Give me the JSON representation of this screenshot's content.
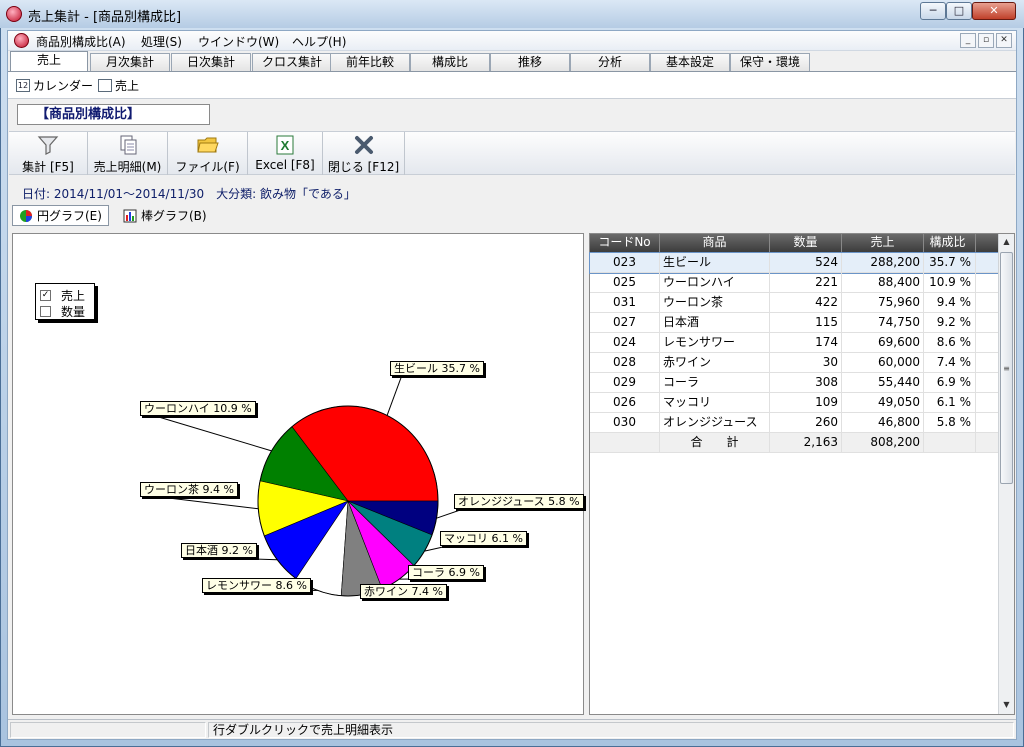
{
  "window": {
    "title": "売上集計 - [商品別構成比]",
    "controls": {
      "minimize": "─",
      "maximize": "□",
      "close": "✕"
    }
  },
  "menu": {
    "items": [
      "商品別構成比(A)",
      "処理(S)",
      "ウインドウ(W)",
      "ヘルプ(H)"
    ],
    "mdi": {
      "minimize": "_",
      "restore": "▫",
      "close": "✕"
    }
  },
  "tabs": [
    "売上",
    "月次集計",
    "日次集計",
    "クロス集計",
    "前年比較",
    "構成比",
    "推移",
    "分析",
    "基本設定",
    "保守・環境"
  ],
  "active_tab": "売上",
  "subnav": {
    "calendar_icon_text": "12",
    "calendar": "カレンダー",
    "sales": "売上"
  },
  "heading": "【商品別構成比】",
  "toolbar": {
    "aggregate": "集計 [F5]",
    "detail": "売上明細(M)",
    "file": "ファイル(F)",
    "excel": "Excel [F8]",
    "close": "閉じる [F12]"
  },
  "info": "日付: 2014/11/01～2014/11/30　大分類: 飲み物「である」",
  "graph_tabs": {
    "pie": "円グラフ(E)",
    "bar": "棒グラフ(B)"
  },
  "legend": {
    "sales": {
      "label": "売上",
      "checked": true
    },
    "qty": {
      "label": "数量",
      "checked": false
    }
  },
  "check_mark": "✓",
  "table": {
    "headers": {
      "code": "コードNo",
      "name": "商品",
      "qty": "数量",
      "sales": "売上",
      "ratio": "構成比"
    },
    "rows": [
      {
        "code": "023",
        "name": "生ビール",
        "qty": "524",
        "sales": "288,200",
        "ratio": "35.7 %"
      },
      {
        "code": "025",
        "name": "ウーロンハイ",
        "qty": "221",
        "sales": "88,400",
        "ratio": "10.9 %"
      },
      {
        "code": "031",
        "name": "ウーロン茶",
        "qty": "422",
        "sales": "75,960",
        "ratio": "9.4 %"
      },
      {
        "code": "027",
        "name": "日本酒",
        "qty": "115",
        "sales": "74,750",
        "ratio": "9.2 %"
      },
      {
        "code": "024",
        "name": "レモンサワー",
        "qty": "174",
        "sales": "69,600",
        "ratio": "8.6 %"
      },
      {
        "code": "028",
        "name": "赤ワイン",
        "qty": "30",
        "sales": "60,000",
        "ratio": "7.4 %"
      },
      {
        "code": "029",
        "name": "コーラ",
        "qty": "308",
        "sales": "55,440",
        "ratio": "6.9 %"
      },
      {
        "code": "026",
        "name": "マッコリ",
        "qty": "109",
        "sales": "49,050",
        "ratio": "6.1 %"
      },
      {
        "code": "030",
        "name": "オレンジジュース",
        "qty": "260",
        "sales": "46,800",
        "ratio": "5.8 %"
      }
    ],
    "total": {
      "label": "合　　計",
      "qty": "2,163",
      "sales": "808,200"
    }
  },
  "scroll": {
    "up": "▲",
    "down": "▼",
    "grip": "≡"
  },
  "status": {
    "message": "行ダブルクリックで売上明細表示"
  },
  "chart_data": {
    "type": "pie",
    "categories": [
      "生ビール",
      "ウーロンハイ",
      "ウーロン茶",
      "日本酒",
      "レモンサワー",
      "赤ワイン",
      "コーラ",
      "マッコリ",
      "オレンジジュース"
    ],
    "values": [
      35.7,
      10.9,
      9.4,
      9.2,
      8.6,
      7.4,
      6.9,
      6.1,
      5.8
    ],
    "labels": [
      "生ビール 35.7 %",
      "ウーロンハイ 10.9 %",
      "ウーロン茶 9.4 %",
      "日本酒 9.2 %",
      "レモンサワー 8.6 %",
      "赤ワイン 7.4 %",
      "コーラ 6.9 %",
      "マッコリ 6.1 %",
      "オレンジジュース 5.8 %"
    ],
    "colors": [
      "#ff0000",
      "#008000",
      "#ffff00",
      "#0000ff",
      "#ffffff",
      "#808080",
      "#ff00ff",
      "#008080",
      "#000080"
    ],
    "legend": "top-left"
  }
}
